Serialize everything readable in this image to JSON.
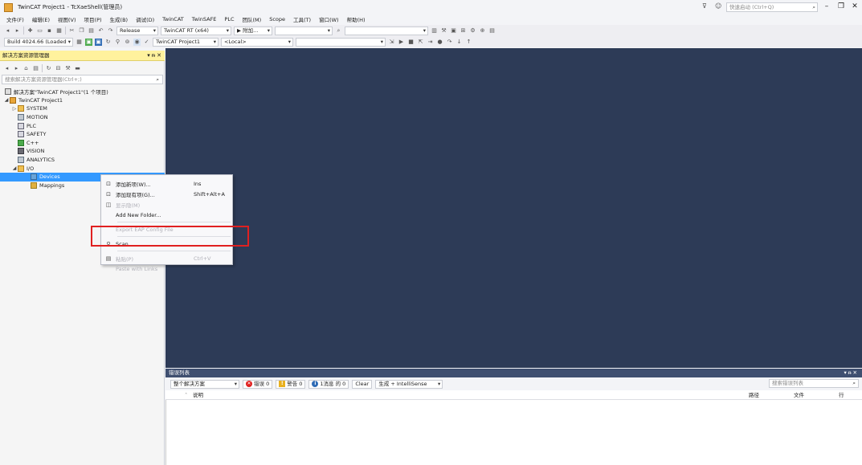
{
  "window": {
    "title": "TwinCAT Project1 - TcXaeShell(管理员)",
    "quick_launch_placeholder": "快速启动 (Ctrl+Q)",
    "minimize": "–",
    "restore": "❐",
    "close": "✕"
  },
  "menubar": [
    "文件(F)",
    "编辑(E)",
    "视图(V)",
    "项目(P)",
    "生成(B)",
    "调试(D)",
    "TwinCAT",
    "TwinSAFE",
    "PLC",
    "团队(M)",
    "Scope",
    "工具(T)",
    "窗口(W)",
    "帮助(H)"
  ],
  "toolbar1": {
    "config": "Release",
    "platform": "TwinCAT RT (x64)",
    "attach": "▶ 附加..."
  },
  "toolbar2": {
    "build": "Build 4024.66 (Loaded",
    "project": "TwinCAT Project1",
    "target": "<Local>"
  },
  "solution_explorer": {
    "title": "解决方案资源管理器",
    "header_buttons": "▾ ᵰ ✕",
    "search_placeholder": "搜索解决方案资源管理器(Ctrl+;)",
    "tree": {
      "solution": "解决方案\"TwinCAT Project1\"(1 个项目)",
      "project": "TwinCAT Project1",
      "system": "SYSTEM",
      "motion": "MOTION",
      "plc": "PLC",
      "safety": "SAFETY",
      "cpp": "C++",
      "vision": "VISION",
      "analytics": "ANALYTICS",
      "io": "I/O",
      "devices": "Devices",
      "mappings": "Mappings"
    }
  },
  "context_menu": {
    "add_new": {
      "label": "添加新项(W)...",
      "shortcut": "Ins"
    },
    "add_existing": {
      "label": "添加现有项(G)...",
      "shortcut": "Shift+Alt+A"
    },
    "show_hidden": {
      "label": "显示隐(M)"
    },
    "add_folder": {
      "label": "Add New Folder..."
    },
    "export_eap": {
      "label": "Export EAP Config File"
    },
    "scan": {
      "label": "Scan"
    },
    "paste": {
      "label": "粘贴(P)",
      "shortcut": "Ctrl+V"
    },
    "paste_links": {
      "label": "Paste with Links"
    }
  },
  "error_list": {
    "title": "错误列表",
    "header_buttons": "▾ ᵰ ✕",
    "scope": "整个解决方案",
    "errors": "错误 0",
    "warnings": "警告 0",
    "messages": "1消息 的 0",
    "clear": "Clear",
    "build_filter": "生成 + IntelliSense",
    "search_placeholder": "搜索错误列表",
    "columns": {
      "desc": "说明",
      "path": "路径",
      "file": "文件",
      "line": "行"
    }
  },
  "colors": {
    "editor_bg": "#2d3b57",
    "selection": "#3399ff",
    "solution_header": "#fff29d",
    "highlight": "#e02020"
  }
}
